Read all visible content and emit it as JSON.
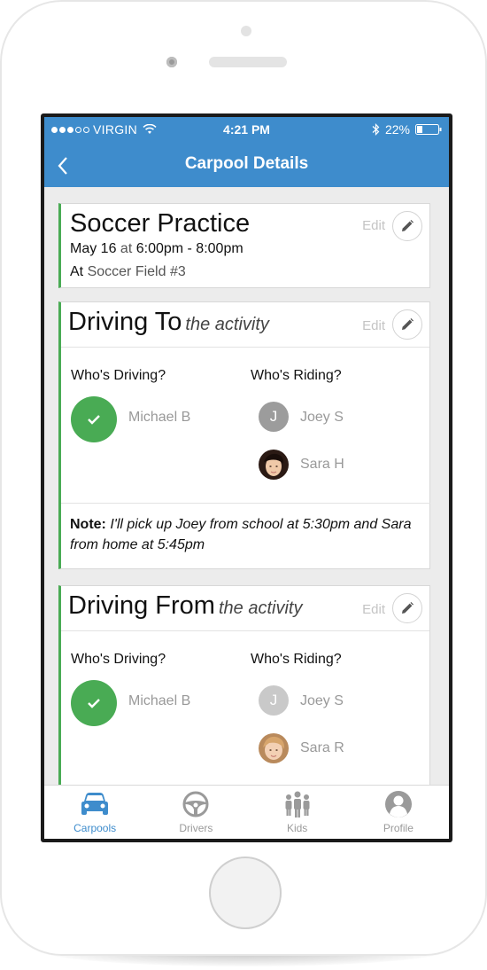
{
  "status_bar": {
    "carrier": "VIRGIN",
    "time": "4:21 PM",
    "battery": "22%"
  },
  "nav": {
    "title": "Carpool Details"
  },
  "event": {
    "title": "Soccer Practice",
    "date": "May 16",
    "at_word": "at",
    "time_range": "6:00pm - 8:00pm",
    "place_prefix": "At",
    "place": "Soccer Field #3",
    "edit_label": "Edit"
  },
  "driving_to": {
    "title": "Driving To",
    "subtitle": "the activity",
    "edit_label": "Edit",
    "driving_label": "Who's Driving?",
    "riding_label": "Who's Riding?",
    "driver": "Michael B",
    "riders": [
      {
        "initial": "J",
        "name": "Joey S"
      },
      {
        "name": "Sara H"
      }
    ],
    "note_label": "Note:",
    "note": "I'll pick up Joey from school at 5:30pm and Sara from home at 5:45pm"
  },
  "driving_from": {
    "title": "Driving From",
    "subtitle": "the activity",
    "edit_label": "Edit",
    "driving_label": "Who's Driving?",
    "riding_label": "Who's Riding?",
    "driver": "Michael B",
    "riders": [
      {
        "initial": "J",
        "name": "Joey S"
      },
      {
        "name": "Sara R"
      }
    ]
  },
  "tabs": [
    {
      "label": "Carpools",
      "icon": "car-icon",
      "active": true
    },
    {
      "label": "Drivers",
      "icon": "steering-wheel-icon",
      "active": false
    },
    {
      "label": "Kids",
      "icon": "kids-icon",
      "active": false
    },
    {
      "label": "Profile",
      "icon": "profile-icon",
      "active": false
    }
  ],
  "colors": {
    "header_blue": "#3e8ccc",
    "accent_green": "#49ab54",
    "screen_bg": "#ececec"
  }
}
